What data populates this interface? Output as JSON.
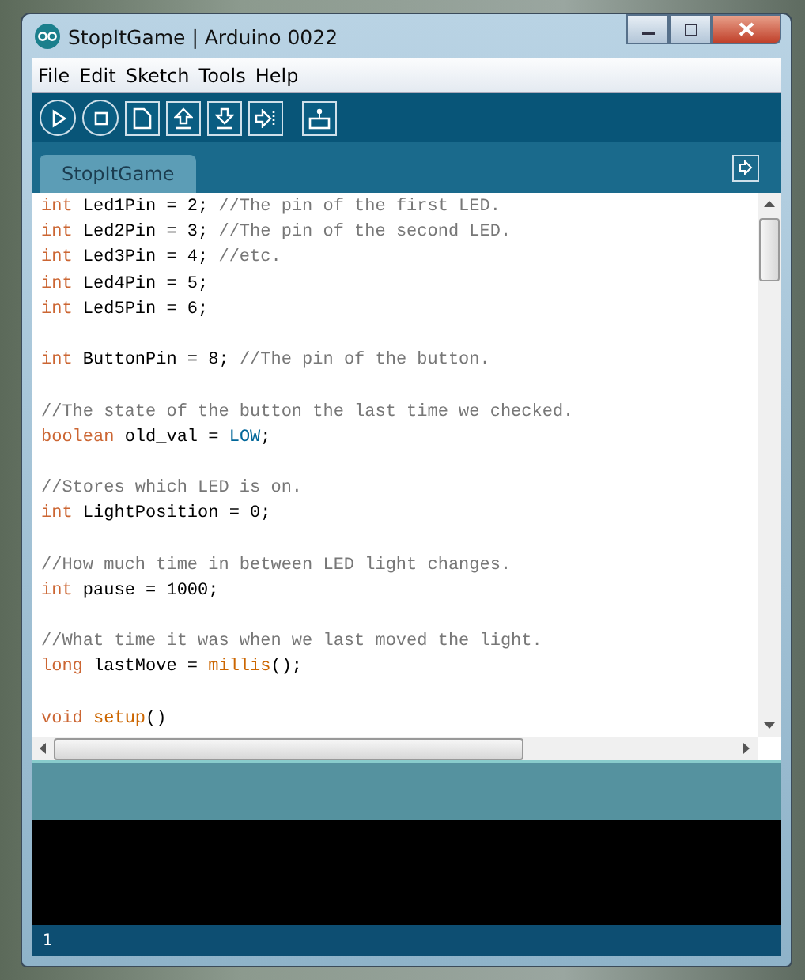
{
  "window": {
    "title": "StopItGame | Arduino 0022"
  },
  "menu": [
    "File",
    "Edit",
    "Sketch",
    "Tools",
    "Help"
  ],
  "toolbar": [
    {
      "kind": "play"
    },
    {
      "kind": "stop"
    },
    {
      "kind": "new"
    },
    {
      "kind": "up"
    },
    {
      "kind": "down"
    },
    {
      "kind": "right"
    },
    {
      "kind": "monitor"
    }
  ],
  "tabs": [
    {
      "label": "StopItGame",
      "selected": true
    }
  ],
  "code": {
    "lines": [
      {
        "kind": "code",
        "tokens": [
          {
            "kind": "keyword",
            "text": "int"
          },
          {
            "kind": "plain",
            "text": " Led1Pin = 2; "
          },
          {
            "kind": "comment",
            "text": "//The pin of the first LED."
          }
        ]
      },
      {
        "kind": "code",
        "tokens": [
          {
            "kind": "keyword",
            "text": "int"
          },
          {
            "kind": "plain",
            "text": " Led2Pin = 3; "
          },
          {
            "kind": "comment",
            "text": "//The pin of the second LED."
          }
        ]
      },
      {
        "kind": "code",
        "tokens": [
          {
            "kind": "keyword",
            "text": "int"
          },
          {
            "kind": "plain",
            "text": " Led3Pin = 4; "
          },
          {
            "kind": "comment",
            "text": "//etc."
          }
        ]
      },
      {
        "kind": "code",
        "tokens": [
          {
            "kind": "keyword",
            "text": "int"
          },
          {
            "kind": "plain",
            "text": " Led4Pin = 5;"
          }
        ]
      },
      {
        "kind": "code",
        "tokens": [
          {
            "kind": "keyword",
            "text": "int"
          },
          {
            "kind": "plain",
            "text": " Led5Pin = 6;"
          }
        ]
      },
      {
        "kind": "blank"
      },
      {
        "kind": "code",
        "tokens": [
          {
            "kind": "keyword",
            "text": "int"
          },
          {
            "kind": "plain",
            "text": " ButtonPin = 8; "
          },
          {
            "kind": "comment",
            "text": "//The pin of the button."
          }
        ]
      },
      {
        "kind": "blank"
      },
      {
        "kind": "code",
        "tokens": [
          {
            "kind": "comment",
            "text": "//The state of the button the last time we checked."
          }
        ]
      },
      {
        "kind": "code",
        "tokens": [
          {
            "kind": "keyword",
            "text": "boolean"
          },
          {
            "kind": "plain",
            "text": " old_val = "
          },
          {
            "kind": "constant",
            "text": "LOW"
          },
          {
            "kind": "plain",
            "text": ";"
          }
        ]
      },
      {
        "kind": "blank"
      },
      {
        "kind": "code",
        "tokens": [
          {
            "kind": "comment",
            "text": "//Stores which LED is on."
          }
        ]
      },
      {
        "kind": "code",
        "tokens": [
          {
            "kind": "keyword",
            "text": "int"
          },
          {
            "kind": "plain",
            "text": " LightPosition = 0;"
          }
        ]
      },
      {
        "kind": "blank"
      },
      {
        "kind": "code",
        "tokens": [
          {
            "kind": "comment",
            "text": "//How much time in between LED light changes."
          }
        ]
      },
      {
        "kind": "code",
        "tokens": [
          {
            "kind": "keyword",
            "text": "int"
          },
          {
            "kind": "plain",
            "text": " pause = 1000;"
          }
        ]
      },
      {
        "kind": "blank"
      },
      {
        "kind": "code",
        "tokens": [
          {
            "kind": "comment",
            "text": "//What time it was when we last moved the light."
          }
        ]
      },
      {
        "kind": "code",
        "tokens": [
          {
            "kind": "keyword",
            "text": "long"
          },
          {
            "kind": "plain",
            "text": " lastMove = "
          },
          {
            "kind": "function",
            "text": "millis"
          },
          {
            "kind": "plain",
            "text": "();"
          }
        ]
      },
      {
        "kind": "blank"
      },
      {
        "kind": "code",
        "tokens": [
          {
            "kind": "keyword",
            "text": "void "
          },
          {
            "kind": "function",
            "text": "setup"
          },
          {
            "kind": "plain",
            "text": "()"
          }
        ]
      }
    ]
  },
  "status_bar": {
    "line": "1"
  }
}
